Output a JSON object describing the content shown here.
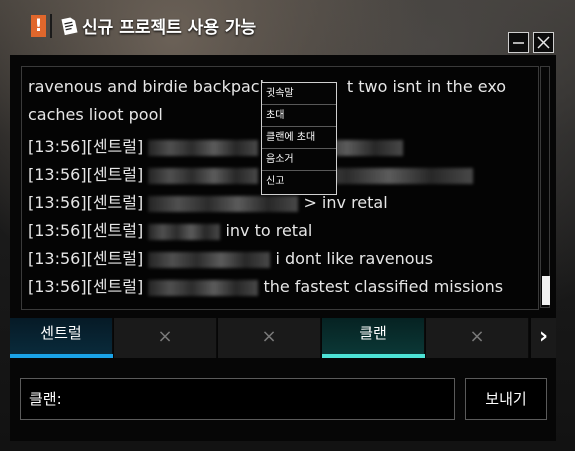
{
  "window": {
    "title": "신규 프로젝트 사용 가능",
    "alert_glyph": "!",
    "icons": [
      "alert-icon",
      "document-icon",
      "minimize-icon",
      "close-icon"
    ]
  },
  "chat": {
    "lines": [
      {
        "text": "ravenous and birdie backpack",
        "tail": "t two isnt in the exo"
      },
      {
        "text": "caches lioot pool"
      },
      {
        "time": "[13:56]",
        "channel": "[센트럴]",
        "msg": ""
      },
      {
        "time": "[13:56]",
        "channel": "[센트럴]",
        "msg": ""
      },
      {
        "time": "[13:56]",
        "channel": "[센트럴]",
        "msg": "> inv retal"
      },
      {
        "time": "[13:56]",
        "channel": "[센트럴]",
        "msg": "inv to retal"
      },
      {
        "time": "[13:56]",
        "channel": "[센트럴]",
        "msg": "i dont like ravenous"
      },
      {
        "time": "[13:56]",
        "channel": "[센트럴]",
        "msg": "the fastest classified missions"
      }
    ]
  },
  "context_menu": {
    "items": [
      "귓속말",
      "초대",
      "클랜에 초대",
      "음소거",
      "신고"
    ]
  },
  "tabs": [
    {
      "label": "센트럴",
      "active": true,
      "accent": "#1aa3e8"
    },
    {
      "label": "×",
      "active": false
    },
    {
      "label": "×",
      "active": false
    },
    {
      "label": "클랜",
      "active": true,
      "accent": "#4de3d6"
    },
    {
      "label": "×",
      "active": false
    }
  ],
  "tab_next_glyph": "›",
  "input": {
    "value": "클랜:"
  },
  "send_button": {
    "label": "보내기"
  },
  "colors": {
    "alert": "#e0672c",
    "central_accent": "#1aa3e8",
    "clan_accent": "#4de3d6"
  }
}
